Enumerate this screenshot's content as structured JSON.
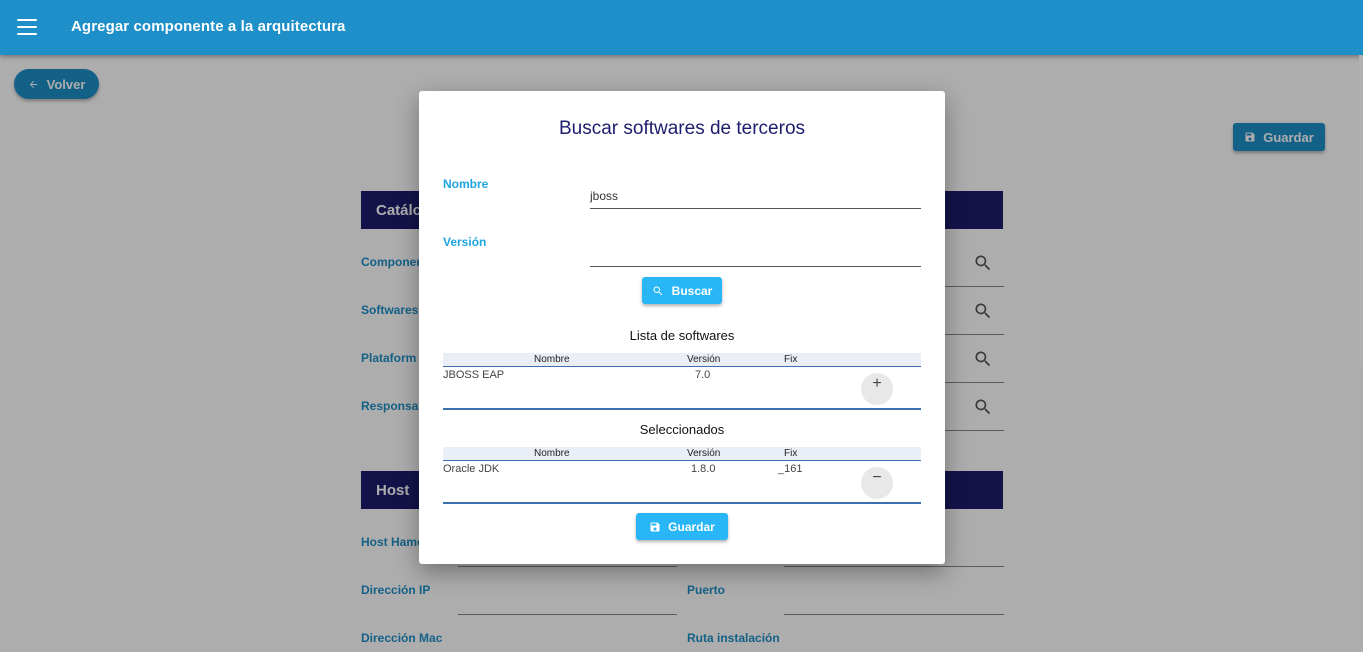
{
  "app": {
    "title": "Agregar componente a la arquitectura"
  },
  "actions": {
    "back_label": "Volver",
    "save_label": "Guardar"
  },
  "background": {
    "section_catalog": "Catálo",
    "section_host": "Host",
    "catalog_fields": [
      "Componen",
      "Softwares d",
      "Plataform",
      "Responsab"
    ],
    "host_fields_left": [
      "Host Hame",
      "Dirección IP",
      "Dirección Mac"
    ],
    "host_fields_right": [
      "Puerto",
      "Ruta instalación"
    ]
  },
  "modal": {
    "title": "Buscar softwares de terceros",
    "nombre_label": "Nombre",
    "nombre_value": "jboss",
    "version_label": "Versión",
    "version_value": "",
    "search_label": "Buscar",
    "list_title": "Lista de softwares",
    "selected_title": "Seleccionados",
    "columns": {
      "nombre": "Nombre",
      "version": "Versión",
      "fix": "Fix"
    },
    "results": [
      {
        "nombre": "JBOSS EAP",
        "version": "7.0",
        "fix": "",
        "action": "+"
      }
    ],
    "selected": [
      {
        "nombre": "Oracle JDK",
        "version": "1.8.0",
        "fix": "_161",
        "action": "−"
      }
    ],
    "save_label": "Guardar"
  },
  "colors": {
    "primary": "#1e8fc8",
    "accent": "#29b6f6",
    "header_dark": "#1d1d6e"
  },
  "icons": {
    "menu": "menu-icon",
    "back": "arrow-left-icon",
    "save": "save-icon",
    "search": "search-icon"
  }
}
